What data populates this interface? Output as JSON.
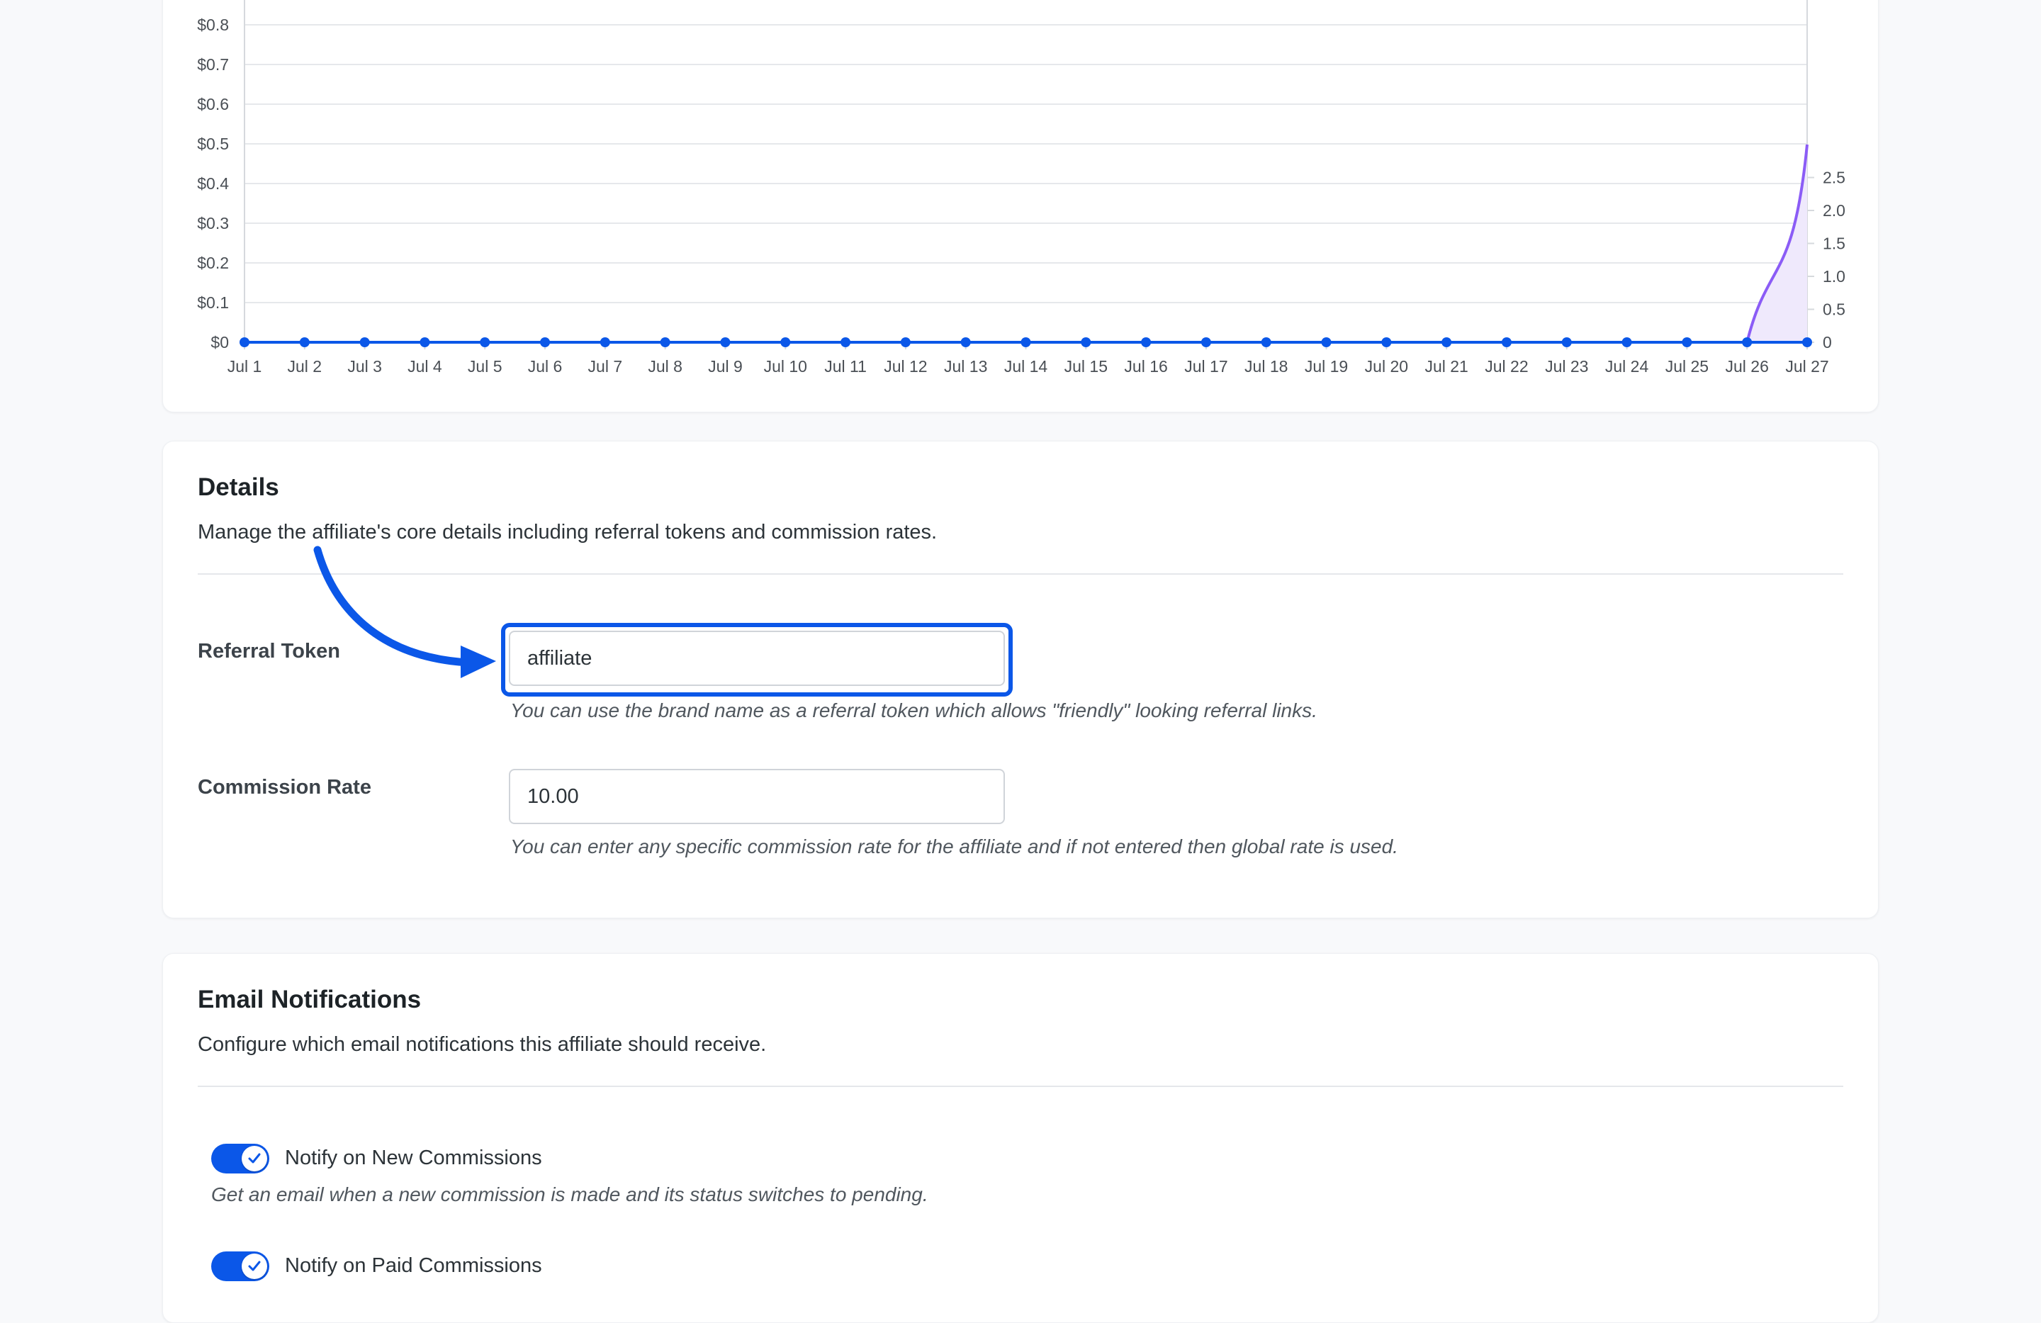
{
  "chart_data": {
    "type": "line",
    "categories": [
      "Jul 1",
      "Jul 2",
      "Jul 3",
      "Jul 4",
      "Jul 5",
      "Jul 6",
      "Jul 7",
      "Jul 8",
      "Jul 9",
      "Jul 10",
      "Jul 11",
      "Jul 12",
      "Jul 13",
      "Jul 14",
      "Jul 15",
      "Jul 16",
      "Jul 17",
      "Jul 18",
      "Jul 19",
      "Jul 20",
      "Jul 21",
      "Jul 22",
      "Jul 23",
      "Jul 24",
      "Jul 25",
      "Jul 26",
      "Jul 27"
    ],
    "left_axis": {
      "ticks": [
        "$0",
        "$0.1",
        "$0.2",
        "$0.3",
        "$0.4",
        "$0.5",
        "$0.6",
        "$0.7",
        "$0.8"
      ],
      "ylim": [
        0,
        0.8
      ]
    },
    "right_axis": {
      "ticks": [
        "0",
        "0.5",
        "1.0",
        "1.5",
        "2.0",
        "2.5"
      ],
      "ylim": [
        0,
        2.5
      ]
    },
    "series": [
      {
        "axis": "left",
        "color": "#0b57e8",
        "values": [
          0,
          0,
          0,
          0,
          0,
          0,
          0,
          0,
          0,
          0,
          0,
          0,
          0,
          0,
          0,
          0,
          0,
          0,
          0,
          0,
          0,
          0,
          0,
          0,
          0,
          0,
          0
        ]
      },
      {
        "axis": "right",
        "color": "#8b5cf6",
        "fill": "#efe9fc",
        "values": [
          0,
          0,
          0,
          0,
          0,
          0,
          0,
          0,
          0,
          0,
          0,
          0,
          0,
          0,
          0,
          0,
          0,
          0,
          0,
          0,
          0,
          0,
          0,
          0,
          0,
          0,
          3
        ]
      }
    ],
    "grid": true
  },
  "details": {
    "title": "Details",
    "description": "Manage the affiliate's core details including referral tokens and commission rates.",
    "referral_token": {
      "label": "Referral Token",
      "value": "affiliate",
      "help": "You can use the brand name as a referral token which allows \"friendly\" looking referral links."
    },
    "commission_rate": {
      "label": "Commission Rate",
      "value": "10.00",
      "help": "You can enter any specific commission rate for the affiliate and if not entered then global rate is used."
    },
    "annotation_color": "#0b57e8"
  },
  "email": {
    "title": "Email Notifications",
    "description": "Configure which email notifications this affiliate should receive.",
    "toggles": [
      {
        "label": "Notify on New Commissions",
        "help": "Get an email when a new commission is made and its status switches to pending.",
        "on": true
      },
      {
        "label": "Notify on Paid Commissions",
        "on": true
      }
    ]
  },
  "colors": {
    "accent": "#0b57e8",
    "secondary_series": "#8b5cf6"
  }
}
